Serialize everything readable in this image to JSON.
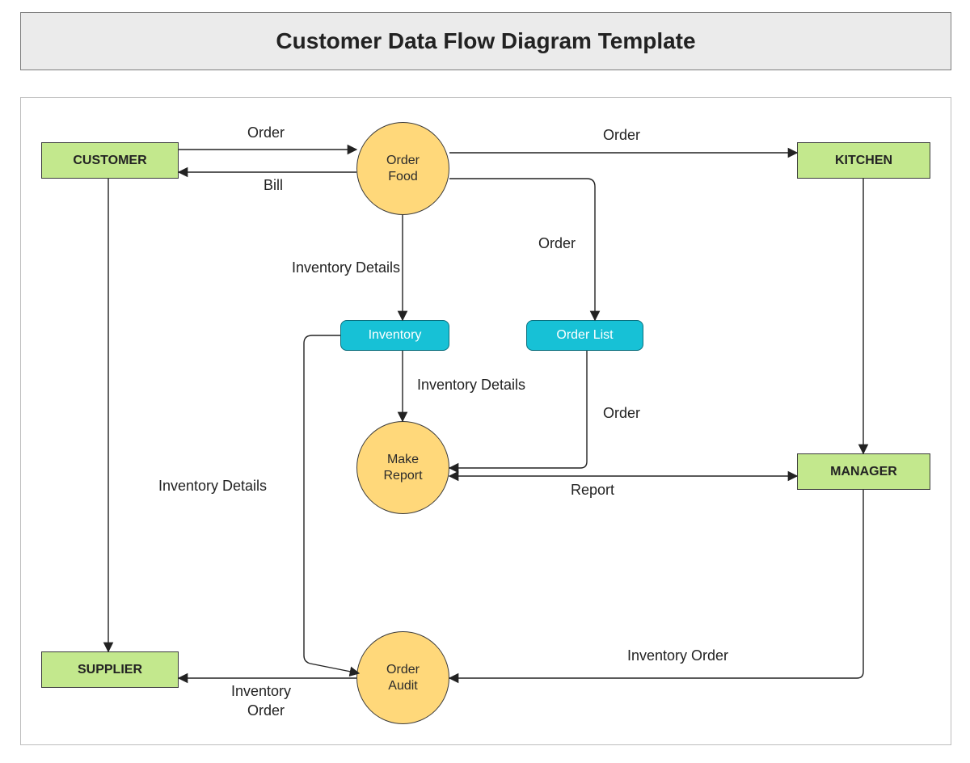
{
  "title": "Customer Data Flow Diagram Template",
  "entities": {
    "customer": "CUSTOMER",
    "kitchen": "KITCHEN",
    "manager": "MANAGER",
    "supplier": "SUPPLIER"
  },
  "processes": {
    "orderFood": "Order\nFood",
    "makeReport": "Make\nReport",
    "orderAudit": "Order\nAudit"
  },
  "stores": {
    "inventory": "Inventory",
    "orderList": "Order List"
  },
  "flows": {
    "customer_order": "Order",
    "bill": "Bill",
    "order_kitchen": "Order",
    "ofood_orderlist": "Order",
    "ofood_inventory": "Inventory Details",
    "inv_report": "Inventory Details",
    "orderlist_report": "Order",
    "report_manager": "Report",
    "manager_audit": "Inventory Order",
    "audit_supplier_l1": "Inventory",
    "audit_supplier_l2": "Order",
    "inv_audit": "Inventory Details"
  }
}
